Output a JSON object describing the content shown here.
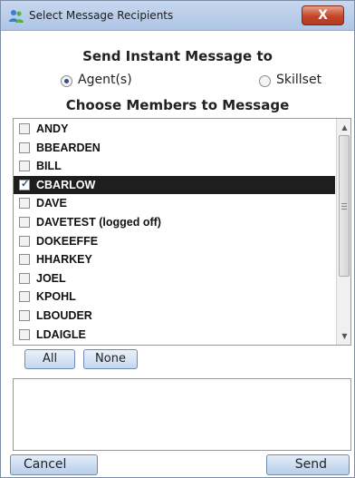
{
  "window": {
    "title": "Select Message Recipients",
    "close_symbol": "X"
  },
  "send_heading": "Send Instant Message to",
  "target": {
    "options": [
      {
        "label": "Agent(s)",
        "checked": true
      },
      {
        "label": "Skillset",
        "checked": false
      }
    ]
  },
  "members_heading": "Choose Members to Message",
  "members": [
    {
      "label": "ANDY",
      "checked": false,
      "selected": false
    },
    {
      "label": "BBEARDEN",
      "checked": false,
      "selected": false
    },
    {
      "label": "BILL",
      "checked": false,
      "selected": false
    },
    {
      "label": "CBARLOW",
      "checked": true,
      "selected": true
    },
    {
      "label": "DAVE",
      "checked": false,
      "selected": false
    },
    {
      "label": "DAVETEST (logged off)",
      "checked": false,
      "selected": false
    },
    {
      "label": "DOKEEFFE",
      "checked": false,
      "selected": false
    },
    {
      "label": "HHARKEY",
      "checked": false,
      "selected": false
    },
    {
      "label": "JOEL",
      "checked": false,
      "selected": false
    },
    {
      "label": "KPOHL",
      "checked": false,
      "selected": false
    },
    {
      "label": "LBOUDER",
      "checked": false,
      "selected": false
    },
    {
      "label": "LDAIGLE",
      "checked": false,
      "selected": false
    }
  ],
  "buttons": {
    "all": "All",
    "none": "None",
    "cancel": "Cancel",
    "send": "Send"
  },
  "message": {
    "value": ""
  },
  "colors": {
    "titlebar": "#b9cdea",
    "selection": "#1e1e1e",
    "button_border": "#6e8bb3"
  }
}
